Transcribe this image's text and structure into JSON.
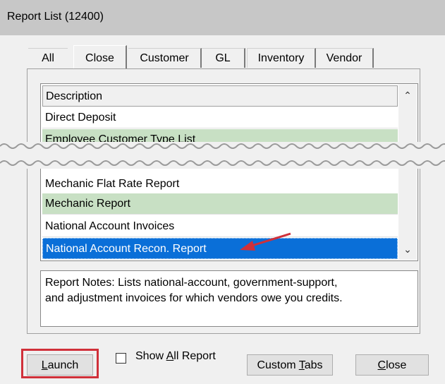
{
  "window": {
    "title": "Report List (12400)"
  },
  "tabs": [
    {
      "label": "All"
    },
    {
      "label": "Close"
    },
    {
      "label": "Customer"
    },
    {
      "label": "GL"
    },
    {
      "label": "Inventory"
    },
    {
      "label": "Vendor"
    }
  ],
  "list": {
    "header": "Description",
    "top_rows": [
      {
        "label": "Direct Deposit"
      },
      {
        "label": "Employee Customer Type List"
      }
    ],
    "bottom_rows": [
      {
        "label": "Mechanic Flat Rate Report"
      },
      {
        "label": "Mechanic Report"
      },
      {
        "label": "National Account Invoices"
      },
      {
        "label": "National Account Recon. Report"
      }
    ],
    "row_color_green": "#c8e0c4",
    "selected_color": "#0a6fd8"
  },
  "notes": {
    "line1": "Report Notes:  Lists national-account, government-support,",
    "line2": "and adjustment invoices for which vendors owe you credits."
  },
  "buttons": {
    "launch_u": "L",
    "launch_rest": "aunch",
    "show_pre": "Show ",
    "show_u": "A",
    "show_rest": "ll Report",
    "custom_pre": "Custom ",
    "custom_u": "T",
    "custom_rest": "abs",
    "close_u": "C",
    "close_rest": "lose"
  },
  "icons": {
    "scroll_up": "chevron-up-icon",
    "scroll_down": "chevron-down-icon",
    "annotation": "red-arrow-icon"
  }
}
